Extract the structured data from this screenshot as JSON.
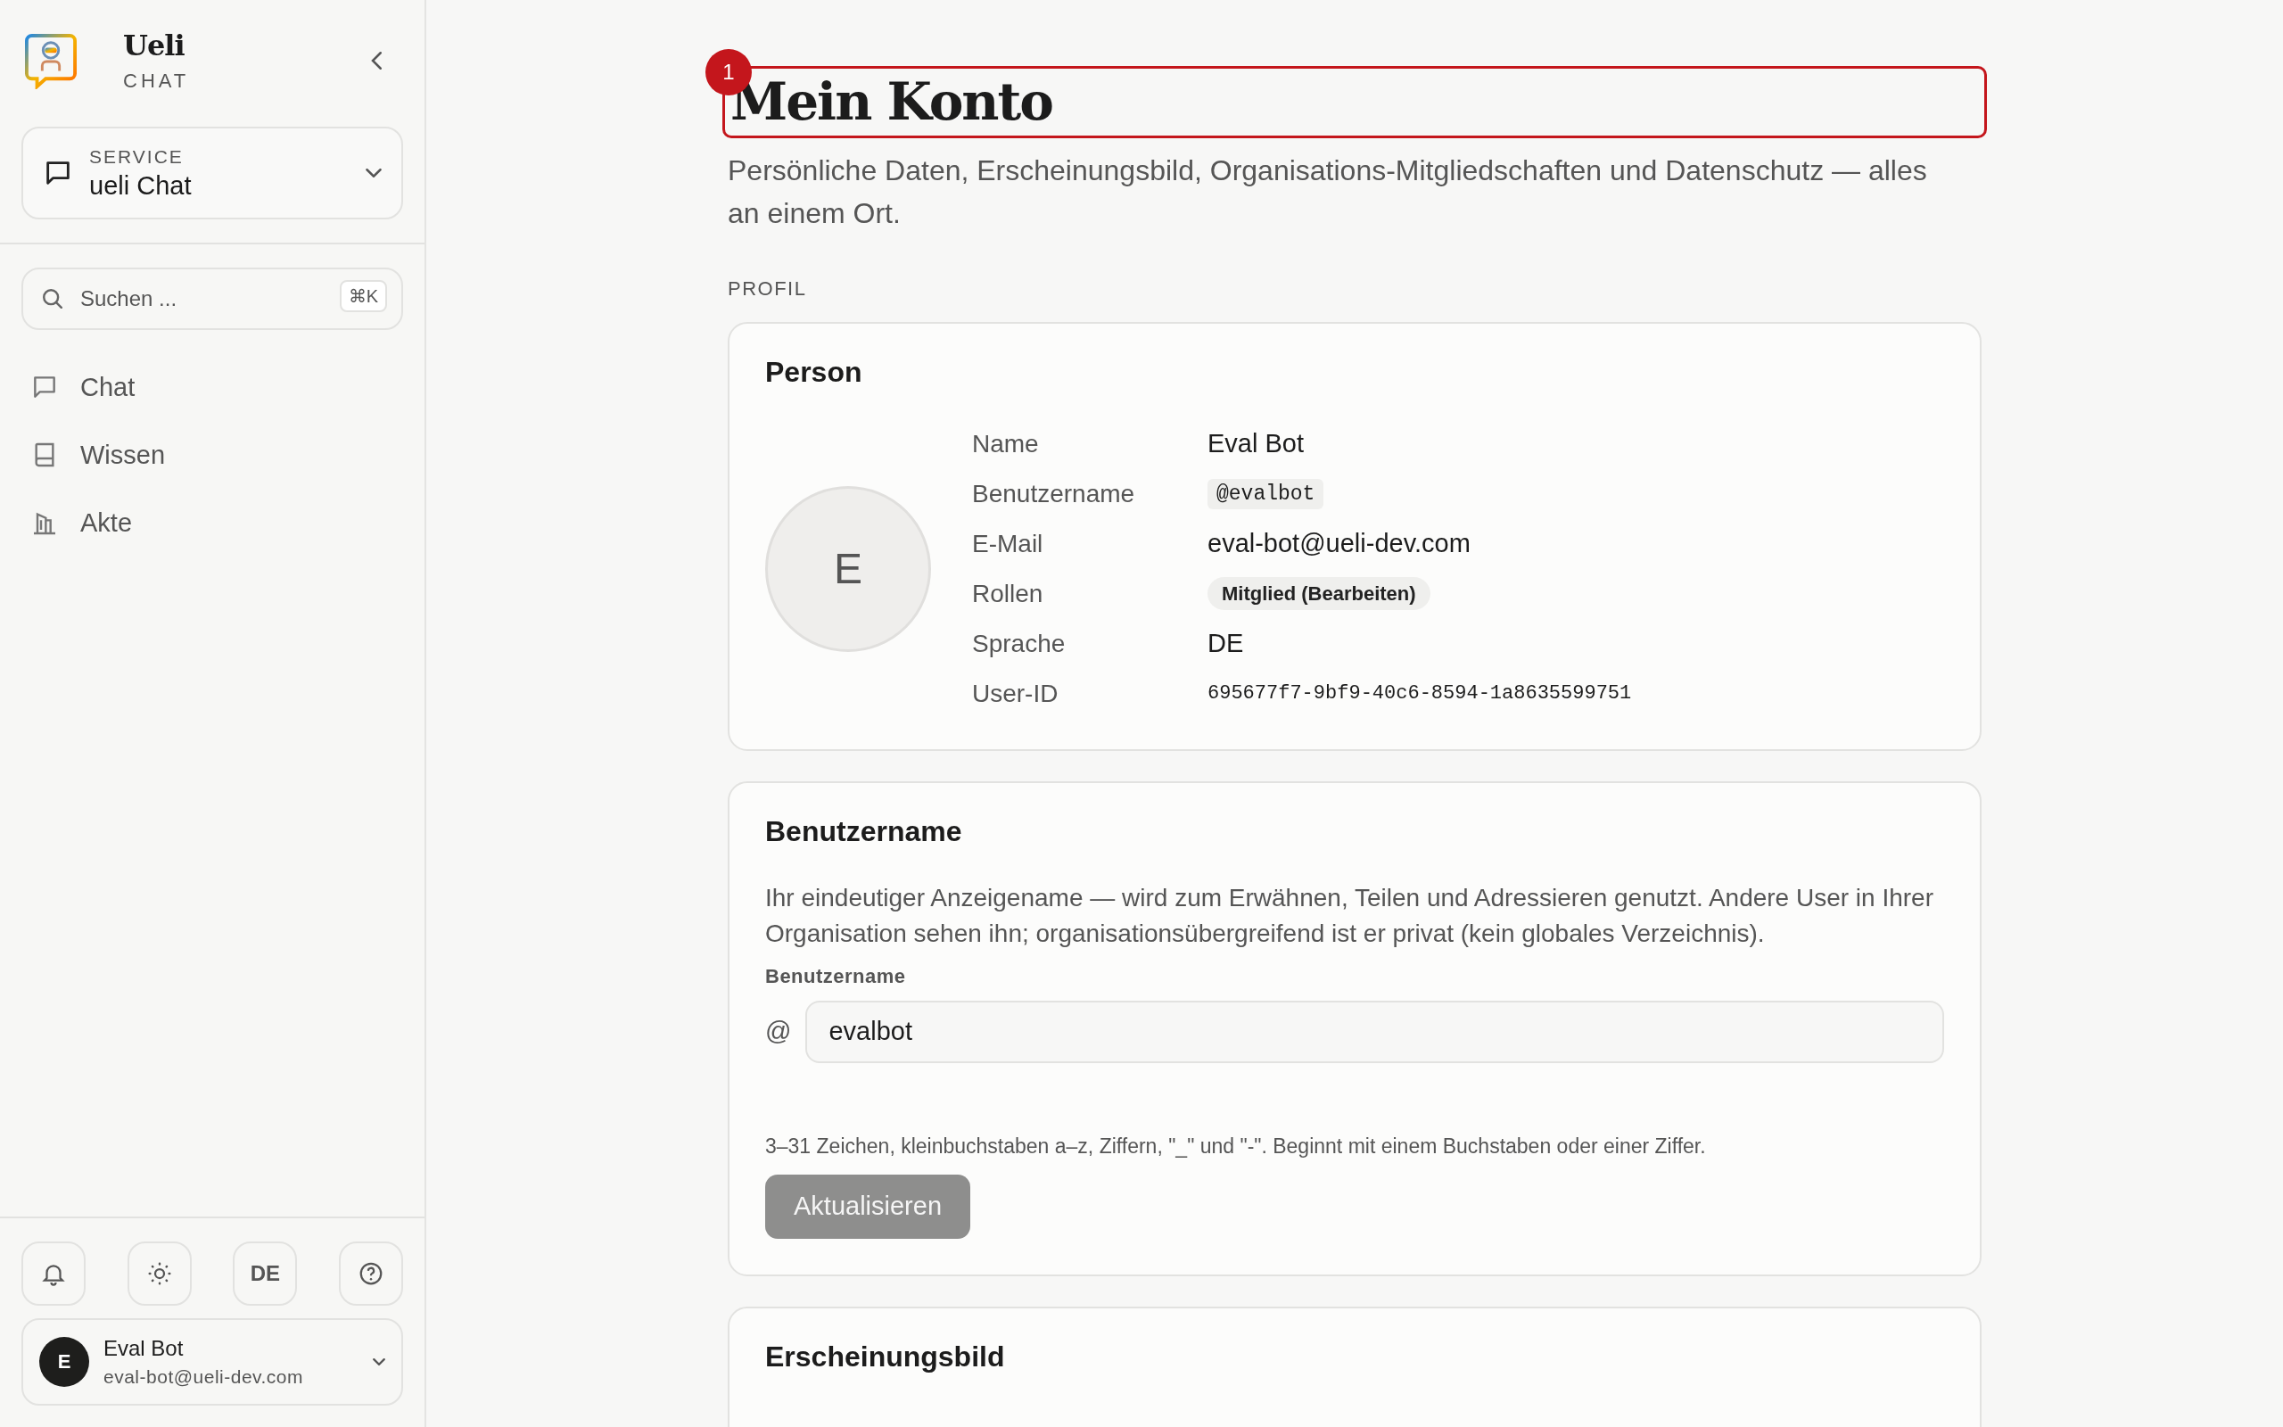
{
  "sidebar": {
    "brand": {
      "name": "Ueli",
      "subtitle": "CHAT"
    },
    "service": {
      "label": "SERVICE",
      "value": "ueli Chat"
    },
    "search": {
      "placeholder": "Suchen ...",
      "shortcut": "⌘K"
    },
    "nav": [
      {
        "label": "Chat"
      },
      {
        "label": "Wissen"
      },
      {
        "label": "Akte"
      }
    ],
    "tools": [
      {
        "kind": "bell"
      },
      {
        "kind": "sun"
      },
      {
        "kind": "text",
        "label": "DE"
      },
      {
        "kind": "help"
      }
    ],
    "user": {
      "initial": "E",
      "name": "Eval Bot",
      "email": "eval-bot@ueli-dev.com"
    }
  },
  "page": {
    "title": "Mein Konto",
    "annotation": {
      "label": "1"
    },
    "subtitle": "Persönliche Daten, Erscheinungsbild, Organisations-Mitgliedschaften und Datenschutz — alles an einem Ort.",
    "section": "PROFIL"
  },
  "person": {
    "title": "Person",
    "initial": "E",
    "rows": [
      {
        "label": "Name",
        "value": "Eval Bot",
        "kind": "text"
      },
      {
        "label": "Benutzername",
        "value": "@evalbot",
        "kind": "code"
      },
      {
        "label": "E-Mail",
        "value": "eval-bot@ueli-dev.com",
        "kind": "text"
      },
      {
        "label": "Rollen",
        "value": "Mitglied (Bearbeiten)",
        "kind": "pill"
      },
      {
        "label": "Sprache",
        "value": "DE",
        "kind": "text"
      },
      {
        "label": "User-ID",
        "value": "695677f7-9bf9-40c6-8594-1a8635599751",
        "kind": "mono"
      }
    ]
  },
  "username": {
    "title": "Benutzername",
    "description": "Ihr eindeutiger Anzeigename — wird zum Erwähnen, Teilen und Adressieren genutzt. Andere User in Ihrer Organisation sehen ihn; organisationsübergreifend ist er privat (kein globales Verzeichnis).",
    "field_label": "Benutzername",
    "prefix": "@",
    "value": "evalbot",
    "hint": "3–31 Zeichen, kleinbuchstaben a–z, Ziffern, \"_\" und \"-\". Beginnt mit einem Buchstaben oder einer Ziffer.",
    "button": {
      "label": "Aktualisieren",
      "disabled": true
    }
  },
  "appearance": {
    "title": "Erscheinungsbild"
  }
}
